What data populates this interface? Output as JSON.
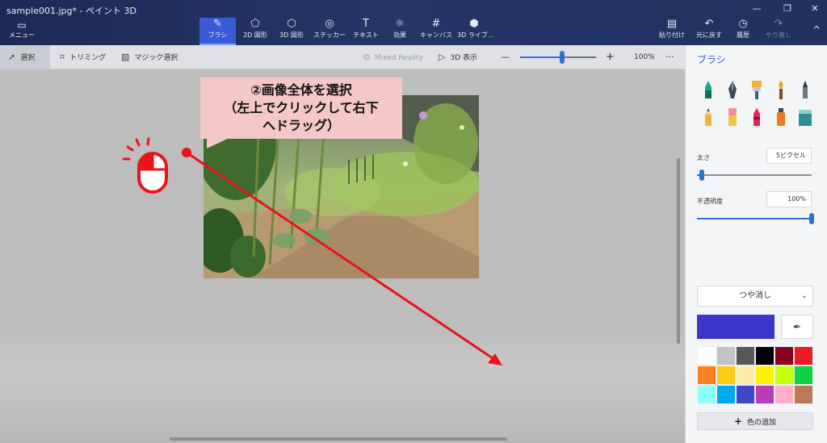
{
  "window": {
    "title": "sample001.jpg* - ペイント 3D",
    "minimize": "—",
    "restore": "❐",
    "close": "✕"
  },
  "ribbon": {
    "menu": {
      "label": "メニュー",
      "icon": "menu-icon"
    },
    "tools": [
      {
        "label": "ブラシ",
        "icon": "brush-icon"
      },
      {
        "label": "2D 図形",
        "icon": "2d-shapes-icon"
      },
      {
        "label": "3D 図形",
        "icon": "3d-shapes-icon"
      },
      {
        "label": "ステッカー",
        "icon": "sticker-icon"
      },
      {
        "label": "テキスト",
        "icon": "text-icon"
      },
      {
        "label": "効果",
        "icon": "effects-icon"
      },
      {
        "label": "キャンバス",
        "icon": "canvas-icon"
      },
      {
        "label": "3D ライブ...",
        "icon": "3d-library-icon"
      }
    ],
    "actions": [
      {
        "label": "貼り付け",
        "icon": "paste-icon"
      },
      {
        "label": "元に戻す",
        "icon": "undo-icon"
      },
      {
        "label": "履歴",
        "icon": "history-icon"
      },
      {
        "label": "やり直し",
        "icon": "redo-icon"
      }
    ],
    "collapse_icon": "^"
  },
  "subtoolbar": {
    "select": "選択",
    "crop": "トリミング",
    "magic_select": "マジック選択",
    "mixed_reality": "Mixed Reality",
    "view_3d": "3D 表示",
    "zoom_minus": "—",
    "zoom_plus": "+",
    "zoom_value": "100%",
    "zoom_level": 0.55,
    "more": "···"
  },
  "callout": {
    "line1": "②画像全体を選択",
    "line2": "（左上でクリックして右下",
    "line3": "へドラッグ）"
  },
  "panel": {
    "title": "ブラシ",
    "brushes": [
      "marker",
      "calligraphy-pen",
      "oil-brush",
      "watercolor",
      "pixel-pen",
      "pencil",
      "eraser",
      "crayon",
      "spray-can",
      "fill"
    ],
    "thickness_label": "太さ",
    "thickness_value": "5ピクセル",
    "thickness_level": 0.04,
    "opacity_label": "不透明度",
    "opacity_value": "100%",
    "opacity_level": 1.0,
    "finish": "つや消し",
    "current_color": "#3b38c9",
    "palette": [
      "#ffffff",
      "#c3c3c3",
      "#585858",
      "#000000",
      "#88001b",
      "#ec1c24",
      "#ff7f27",
      "#ffca18",
      "#fdeca6",
      "#fff200",
      "#c4ff0e",
      "#0ed145",
      "#8cfffb",
      "#00a8f3",
      "#3f48cc",
      "#b83dba",
      "#ffaec8",
      "#b97a56"
    ],
    "add_color": "色の追加"
  }
}
